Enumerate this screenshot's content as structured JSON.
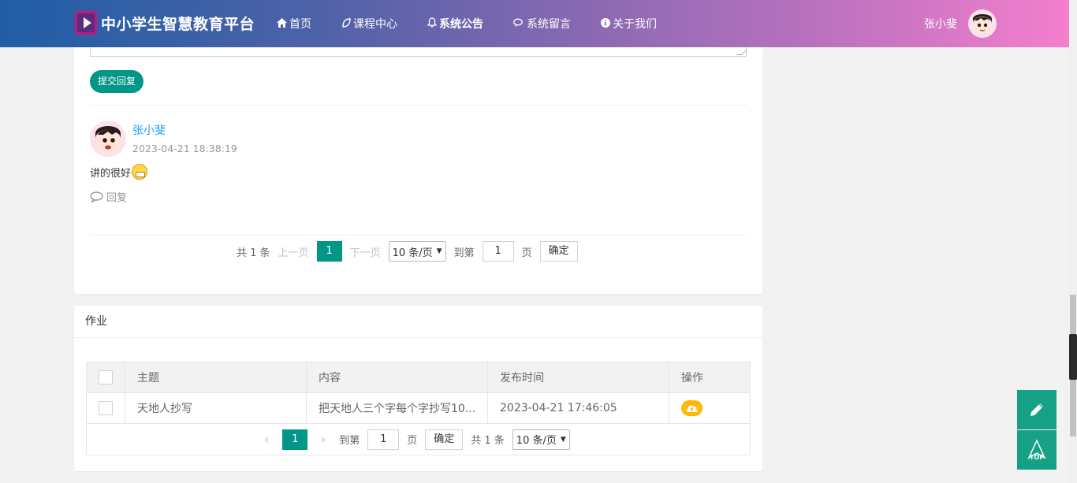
{
  "header": {
    "logo_text": "中小学生智慧教育平台",
    "nav": [
      {
        "label": "首页",
        "icon": "home-icon"
      },
      {
        "label": "课程中心",
        "icon": "leaf-icon"
      },
      {
        "label": "系统公告",
        "icon": "bell-icon"
      },
      {
        "label": "系统留言",
        "icon": "chat-icon"
      },
      {
        "label": "关于我们",
        "icon": "info-icon"
      }
    ],
    "user_name": "张小斐"
  },
  "comments": {
    "submit_label": "提交回复",
    "items": [
      {
        "author": "张小斐",
        "time": "2023-04-21 18:38:19",
        "text": "讲的很好",
        "reply_label": "回复"
      }
    ],
    "pager": {
      "total": "共 1 条",
      "prev": "上一页",
      "current": "1",
      "next": "下一页",
      "page_size": "10 条/页",
      "goto_label": "到第",
      "goto_value": "1",
      "page_suffix": "页",
      "confirm": "确定"
    }
  },
  "homework": {
    "title": "作业",
    "columns": [
      "主题",
      "内容",
      "发布时间",
      "操作"
    ],
    "rows": [
      {
        "subject": "天地人抄写",
        "content": "把天地人三个字每个字抄写10...",
        "time": "2023-04-21 17:46:05"
      }
    ],
    "pager": {
      "current": "1",
      "goto_label": "到第",
      "goto_value": "1",
      "page_suffix": "页",
      "confirm": "确定",
      "total": "共 1 条",
      "page_size": "10 条/页"
    }
  },
  "floating": {
    "top_label": "TOP"
  },
  "colors": {
    "accent": "#009688",
    "link": "#1e9fff",
    "warning": "#ffb800",
    "fab": "#16a085"
  }
}
